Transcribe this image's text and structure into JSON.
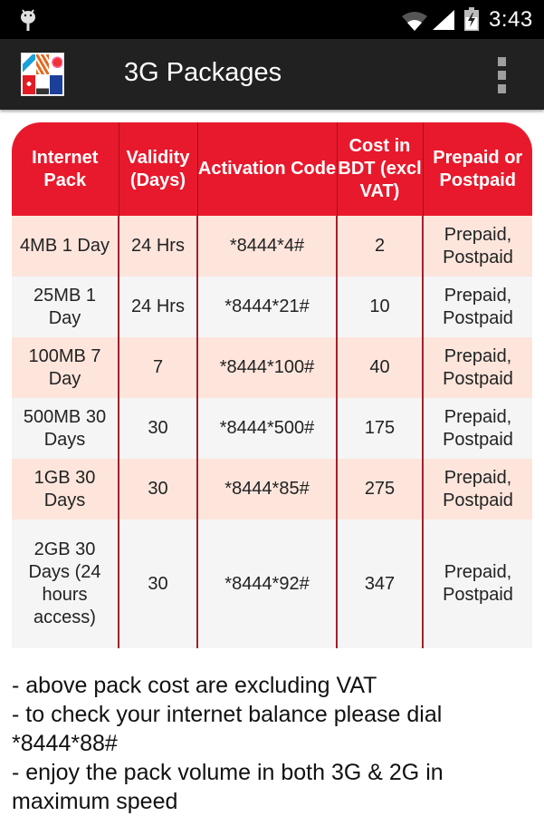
{
  "status_bar": {
    "time": "3:43",
    "icons": [
      "android-debug-icon",
      "wifi-icon",
      "cell-signal-icon",
      "battery-charging-icon"
    ]
  },
  "action_bar": {
    "title": "3G Packages",
    "logo": "telecom-operators-logo",
    "overflow": "overflow-menu-icon"
  },
  "colors": {
    "header_red": "#e8192c",
    "row_pink": "#fde5dc",
    "row_gray": "#f5f5f5",
    "divider": "#a3202a"
  },
  "table": {
    "headers": [
      "Internet Pack",
      "Validity (Days)",
      "Activation Code",
      "Cost in BDT (excl VAT)",
      "Prepaid or Postpaid"
    ],
    "rows": [
      {
        "pack": "4MB 1 Day",
        "validity": "24 Hrs",
        "code": "*8444*4#",
        "cost": "2",
        "type": "Prepaid, Postpaid"
      },
      {
        "pack": "25MB 1 Day",
        "validity": "24 Hrs",
        "code": "*8444*21#",
        "cost": "10",
        "type": "Prepaid, Postpaid"
      },
      {
        "pack": "100MB 7 Day",
        "validity": "7",
        "code": "*8444*100#",
        "cost": "40",
        "type": "Prepaid, Postpaid"
      },
      {
        "pack": "500MB 30 Days",
        "validity": "30",
        "code": "*8444*500#",
        "cost": "175",
        "type": "Prepaid, Postpaid"
      },
      {
        "pack": "1GB 30 Days",
        "validity": "30",
        "code": "*8444*85#",
        "cost": "275",
        "type": "Prepaid, Postpaid"
      },
      {
        "pack": "2GB 30 Days (24 hours access)",
        "validity": "30",
        "code": "*8444*92#",
        "cost": "347",
        "type": "Prepaid, Postpaid"
      }
    ]
  },
  "notes": [
    "- above pack cost are excluding VAT",
    "- to check your internet balance please dial *8444*88#",
    "- enjoy the pack volume in both 3G & 2G in maximum speed"
  ]
}
